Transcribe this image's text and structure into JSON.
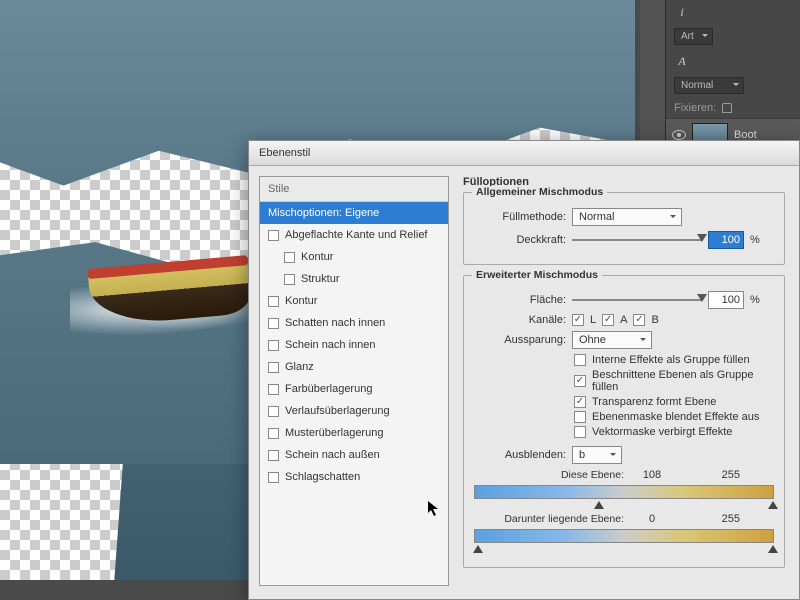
{
  "right_panel": {
    "kind_dropdown": "Art",
    "blend_mode": "Normal",
    "lock_label": "Fixieren:",
    "layer_name": "Boot"
  },
  "dialog": {
    "title": "Ebenenstil",
    "styles_header": "Stile",
    "styles": [
      {
        "label": "Mischoptionen: Eigene",
        "selected": true,
        "checkbox": false
      },
      {
        "label": "Abgeflachte Kante und Relief",
        "checkbox": true
      },
      {
        "label": "Kontur",
        "checkbox": true,
        "indent": true
      },
      {
        "label": "Struktur",
        "checkbox": true,
        "indent": true
      },
      {
        "label": "Kontur",
        "checkbox": true
      },
      {
        "label": "Schatten nach innen",
        "checkbox": true
      },
      {
        "label": "Schein nach innen",
        "checkbox": true
      },
      {
        "label": "Glanz",
        "checkbox": true
      },
      {
        "label": "Farbüberlagerung",
        "checkbox": true
      },
      {
        "label": "Verlaufsüberlagerung",
        "checkbox": true
      },
      {
        "label": "Musterüberlagerung",
        "checkbox": true
      },
      {
        "label": "Schein nach außen",
        "checkbox": true
      },
      {
        "label": "Schlagschatten",
        "checkbox": true
      }
    ],
    "fill_options_title": "Fülloptionen",
    "general_blend": {
      "legend": "Allgemeiner Mischmodus",
      "method_label": "Füllmethode:",
      "method_value": "Normal",
      "opacity_label": "Deckkraft:",
      "opacity_value": "100",
      "percent": "%"
    },
    "advanced_blend": {
      "legend": "Erweiterter Mischmodus",
      "fill_label": "Fläche:",
      "fill_value": "100",
      "percent": "%",
      "channels_label": "Kanäle:",
      "ch_l": "L",
      "ch_a": "A",
      "ch_b": "B",
      "knockout_label": "Aussparung:",
      "knockout_value": "Ohne",
      "opt1": "Interne Effekte als Gruppe füllen",
      "opt2": "Beschnittene Ebenen als Gruppe füllen",
      "opt3": "Transparenz formt Ebene",
      "opt4": "Ebenenmaske blendet Effekte aus",
      "opt5": "Vektormaske verbirgt Effekte"
    },
    "blend_if": {
      "label": "Ausblenden:",
      "channel": "b",
      "this_layer_label": "Diese Ebene:",
      "this_low": "108",
      "this_high": "255",
      "under_label": "Darunter liegende Ebene:",
      "under_low": "0",
      "under_high": "255"
    }
  }
}
